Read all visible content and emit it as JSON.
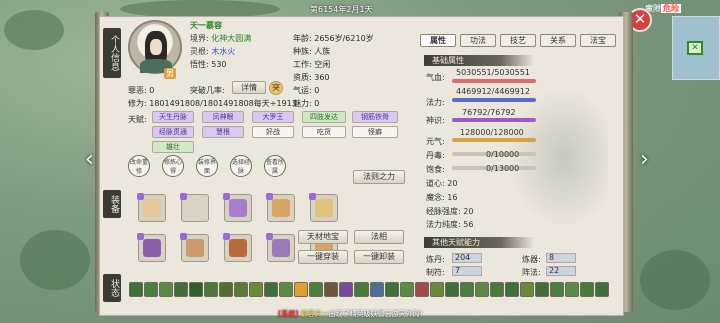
{
  "top": {
    "date": "第6154年2月1天",
    "danger_prefix": "魔隙",
    "danger": "危险"
  },
  "tabs_vertical": {
    "personal_info": "个人信息",
    "equipment": "装备",
    "status": "状态"
  },
  "character": {
    "name": "天一慕容",
    "gender": "男",
    "realm_label": "境界:",
    "realm": "化神大圆满",
    "root_label": "灵根:",
    "root": "木水火",
    "comprehension_label": "悟性:",
    "comprehension": "530",
    "evil_label": "罪恶:",
    "evil": "0",
    "breakthrough_label": "突破几率:",
    "breakthrough_btn": "详情",
    "breakthrough_badge": "突",
    "cultivation_label": "修为:",
    "cultivation": "1801491808/1801491808每天+1913",
    "age_label": "年龄:",
    "age": "2656岁/6210岁",
    "race_label": "种族:",
    "race": "人族",
    "work_label": "工作:",
    "work": "空闲",
    "aptitude_label": "资质:",
    "aptitude": "360",
    "luck_label": "气运:",
    "luck": "0",
    "charm_label": "魅力:",
    "charm": "0",
    "talent_label": "天赋:"
  },
  "talents": [
    {
      "label": "天生丹脉",
      "tier": "purple"
    },
    {
      "label": "凤神眼",
      "tier": "purple"
    },
    {
      "label": "大罗王",
      "tier": "purple"
    },
    {
      "label": "四肢发达",
      "tier": "green"
    },
    {
      "label": "钢筋铁骨",
      "tier": "purple"
    },
    {
      "label": "经脉贯通",
      "tier": "purple"
    },
    {
      "label": "慧根",
      "tier": "purple"
    },
    {
      "label": "好战",
      "tier": "white"
    },
    {
      "label": "吃货",
      "tier": "white"
    },
    {
      "label": "怪癖",
      "tier": "white"
    },
    {
      "label": "雄壮",
      "tier": "green"
    }
  ],
  "round_buttons": [
    "改命重修",
    "修炼心得",
    "装修界面",
    "选择经脉",
    "查看所属"
  ],
  "buttons": {
    "law_power": "法则之力",
    "heaven_treasure": "天材地宝",
    "dharma_form": "法相",
    "one_click_wear": "一键穿装",
    "one_click_remove": "一键卸装"
  },
  "right_tabs": [
    "属性",
    "功法",
    "技艺",
    "关系",
    "法宝"
  ],
  "basic_attrs": {
    "heading": "基础属性",
    "qixue_label": "气血:",
    "qixue": "5030551/5030551",
    "qixue_color": "#d96c6c",
    "fali_label": "法力:",
    "fali": "4469912/4469912",
    "fali_color": "#5a6fd0",
    "shenshi_label": "神识:",
    "shenshi": "76792/76792",
    "shenshi_color": "#9b59c9",
    "yuanqi_label": "元气:",
    "yuanqi": "128000/128000",
    "yuanqi_color": "#d8a24a",
    "danqi_label": "丹毒:",
    "danqi": "0/10000",
    "baoshi_label": "饱食:",
    "baoshi": "0/13000",
    "daoxin_label": "道心:",
    "daoxin": "20",
    "monian_label": "魔念:",
    "monian": "16",
    "jingmai_label": "经脉强度:",
    "jingmai": "20",
    "falichundu_label": "法力纯度:",
    "falichundu": "56"
  },
  "other_talents": {
    "heading": "其他天赋能力",
    "liandan_label": "炼丹:",
    "liandan": "204",
    "lianqi_label": "炼器:",
    "lianqi": "8",
    "zhifu_label": "制符:",
    "zhifu": "7",
    "zhenfa_label": "阵法:",
    "zhenfa": "22"
  },
  "chat": {
    "tag": "[系统]",
    "mid": "慕容天一",
    "text": "出现了精英级妖兽云游天外阁！"
  }
}
